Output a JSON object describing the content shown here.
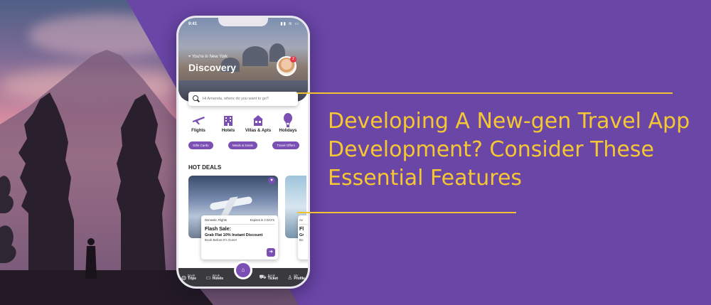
{
  "phone": {
    "status_time": "9:41",
    "location": "You're in New York",
    "screen_title": "Discovery",
    "notification_count": "2",
    "search": {
      "placeholder": "Hi Amanda, where do you want to go?"
    },
    "categories": [
      {
        "label": "Flights",
        "icon": "plane-icon"
      },
      {
        "label": "Hotels",
        "icon": "hotel-icon"
      },
      {
        "label": "Villas & Apts",
        "icon": "villa-icon"
      },
      {
        "label": "Holidays",
        "icon": "balloon-icon"
      }
    ],
    "chips": [
      "Gifts Cards",
      "Meals & Deals",
      "Travel Offers"
    ],
    "hot_deals": {
      "title": "HOT DEALS",
      "card": {
        "type": "Domestic Flights",
        "expires": "Expires in 2 DAYS",
        "headline": "Flash Sale:",
        "offer": "Grab Flat 10% Instant Discount",
        "note": "Book Before It's Gone!"
      },
      "card2": {
        "type": "Av",
        "headline": "Fl",
        "offer": "Gr",
        "note": "Bo"
      }
    },
    "tabs": [
      {
        "line1": "Book",
        "line2": "Trips",
        "icon": "globe-icon"
      },
      {
        "line1": "Book",
        "line2": "Hotels",
        "icon": "bed-icon"
      },
      {
        "line1": "Book",
        "line2": "Ticket",
        "icon": "ticket-icon"
      },
      {
        "line1": "My",
        "line2": "Profile",
        "icon": "user-icon"
      }
    ]
  },
  "headline": {
    "line1": "Developing A New-gen Travel App",
    "line2": "Development? Consider These",
    "line3": "Essential Features"
  },
  "colors": {
    "background": "#6a46a7",
    "accent": "#f5c732",
    "brand": "#7b4fb3"
  }
}
